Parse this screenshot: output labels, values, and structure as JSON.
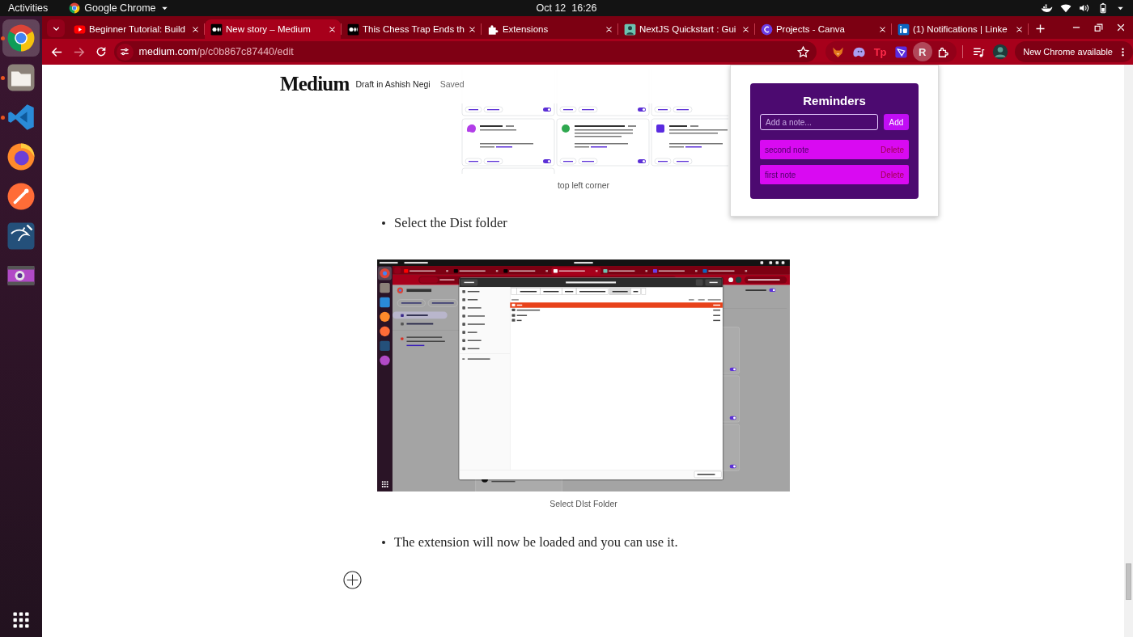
{
  "topbar": {
    "activities": "Activities",
    "app": "Google Chrome",
    "clock": "Oct 12  16:26"
  },
  "dock": [
    {
      "selected": true,
      "running": true
    },
    {
      "selected": false,
      "running": true
    },
    {
      "selected": false,
      "running": true
    },
    {
      "selected": false,
      "running": false
    },
    {
      "selected": false,
      "running": false
    },
    {
      "selected": false,
      "running": false
    },
    {
      "selected": false,
      "running": false
    }
  ],
  "browser": {
    "tabs": [
      {
        "title": "Beginner Tutorial: Build",
        "selected": false
      },
      {
        "title": "New story – Medium",
        "selected": true
      },
      {
        "title": "This Chess Trap Ends th",
        "selected": false
      },
      {
        "title": "Extensions",
        "selected": false
      },
      {
        "title": "NextJS Quickstart : Gui",
        "selected": false
      },
      {
        "title": "Projects - Canva",
        "selected": false
      },
      {
        "title": "(1) Notifications | Linke",
        "selected": false
      }
    ],
    "url": {
      "host": "medium.com",
      "path": "/p/c0b867c87440/edit"
    },
    "extensions": [
      {
        "selected": false
      },
      {
        "selected": false
      },
      {
        "label": "Tp",
        "selected": false
      },
      {
        "selected": false
      },
      {
        "label": "R",
        "selected": true
      },
      {
        "selected": false
      }
    ],
    "update": "New Chrome available"
  },
  "medium_header": {
    "logo": "Medium",
    "draft": "Draft in Ashish Negi",
    "status": "Saved"
  },
  "popup": {
    "title": "Reminders",
    "placeholder": "Add a note...",
    "add": "Add",
    "notes": [
      {
        "text": "second note",
        "action": "Delete"
      },
      {
        "text": "first note",
        "action": "Delete"
      }
    ]
  },
  "article": [
    {
      "kind": "figure",
      "caption": "top left corner",
      "screenshot": {
        "kind": "extension-cards"
      }
    },
    {
      "kind": "bullet",
      "text": "Select the Dist folder"
    },
    {
      "kind": "figure",
      "caption": "Select DIst Folder",
      "screenshot": {
        "kind": "desktop"
      }
    },
    {
      "kind": "bullet",
      "text": "The extension will now be loaded and you can use it."
    }
  ]
}
